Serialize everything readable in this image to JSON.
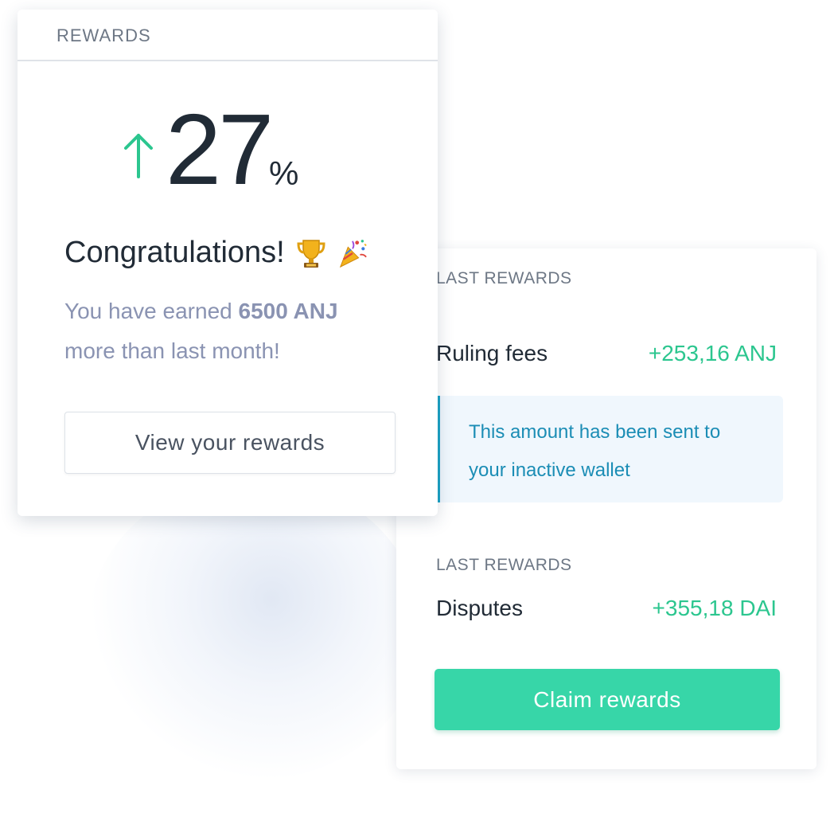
{
  "rewards_card": {
    "title": "REWARDS",
    "percent_value": "27",
    "percent_symbol": "%",
    "trend_icon": "arrow-up-icon",
    "congrats_text": "Congratulations!",
    "congrats_emojis": [
      "trophy-icon",
      "party-popper-icon"
    ],
    "earned_prefix": "You have earned",
    "earned_amount": "6500 ANJ",
    "earned_suffix": "more than last month!",
    "view_button_label": "View your rewards"
  },
  "last_rewards_card": {
    "sections": [
      {
        "label": "LAST REWARDS",
        "item_label": "Ruling fees",
        "item_value": "+253,16 ANJ",
        "note": "This amount has been sent to your inactive wallet"
      },
      {
        "label": "LAST REWARDS",
        "item_label": "Disputes",
        "item_value": "+355,18 DAI"
      }
    ],
    "claim_button_label": "Claim rewards"
  },
  "colors": {
    "accent_green": "#2cc68f",
    "button_green": "#37d6a8",
    "info_blue": "#1b8db5",
    "info_background": "#f0f7fd",
    "text_dark": "#212b36",
    "text_muted": "#8a93b2"
  }
}
